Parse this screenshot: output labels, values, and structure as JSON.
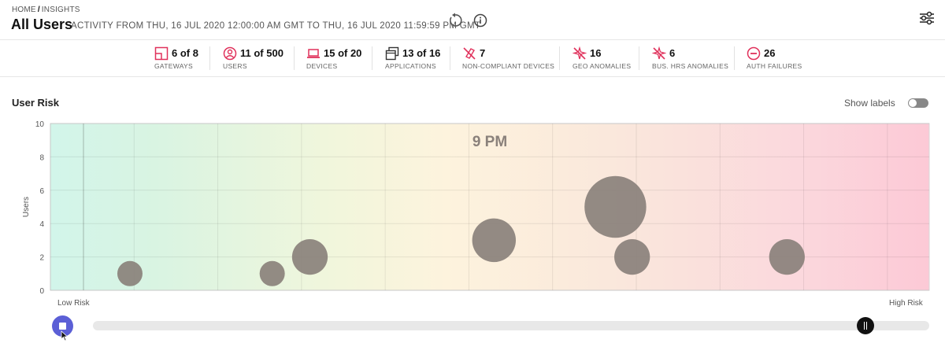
{
  "header": {
    "breadcrumb_home": "HOME",
    "breadcrumb_sep": "/",
    "breadcrumb_current": "INSIGHTS",
    "title": "All Users",
    "activity_range": "ACTIVITY FROM  THU, 16 JUL 2020 12:00:00 AM GMT TO THU, 16 JUL 2020 11:59:59 PM GMT",
    "icons": [
      "refresh-icon",
      "info-icon",
      "filter-settings-icon"
    ]
  },
  "stats": [
    {
      "value": "6 of 8",
      "label": "GATEWAYS",
      "icon": "gateway-icon"
    },
    {
      "value": "11 of 500",
      "label": "USERS",
      "icon": "user-icon"
    },
    {
      "value": "15 of 20",
      "label": "DEVICES",
      "icon": "laptop-icon"
    },
    {
      "value": "13 of 16",
      "label": "APPLICATIONS",
      "icon": "applications-icon"
    },
    {
      "value": "7",
      "label": "NON-COMPLIANT DEVICES",
      "icon": "non-compliant-icon"
    },
    {
      "value": "16",
      "label": "GEO ANOMALIES",
      "icon": "geo-anomaly-icon"
    },
    {
      "value": "6",
      "label": "BUS. HRS ANOMALIES",
      "icon": "bus-hrs-anomaly-icon"
    },
    {
      "value": "26",
      "label": "AUTH FAILURES",
      "icon": "auth-failure-icon"
    }
  ],
  "colors": {
    "accent_red": "#e0315b",
    "play_button": "#5b5fd6",
    "bubble": "#8a817b"
  },
  "user_risk": {
    "title": "User Risk",
    "show_labels": "Show labels",
    "show_labels_on": false,
    "low_risk_label": "Low Risk",
    "high_risk_label": "High Risk"
  },
  "chart_data": {
    "type": "scatter",
    "title": "",
    "time_label": "9 PM",
    "xlabel": "",
    "ylabel": "Users",
    "ylim": [
      0,
      10
    ],
    "yticks": [
      0,
      2,
      4,
      6,
      8,
      10
    ],
    "xlim": [
      0,
      10.5
    ],
    "grid": true,
    "legend": "none",
    "points": [
      {
        "x": 0.95,
        "y": 1,
        "size": 1
      },
      {
        "x": 2.65,
        "y": 1,
        "size": 1
      },
      {
        "x": 3.1,
        "y": 2,
        "size": 2
      },
      {
        "x": 5.3,
        "y": 3,
        "size": 3
      },
      {
        "x": 6.75,
        "y": 5,
        "size": 6
      },
      {
        "x": 6.95,
        "y": 2,
        "size": 2
      },
      {
        "x": 8.8,
        "y": 2,
        "size": 2
      }
    ]
  },
  "timeline": {
    "play_state": "playing",
    "position": 0.924
  }
}
